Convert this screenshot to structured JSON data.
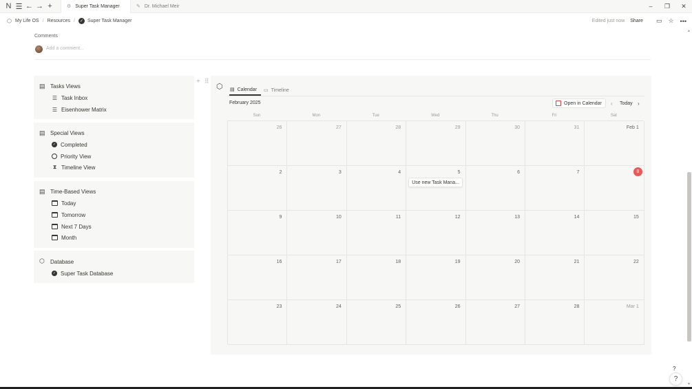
{
  "titlebar": {
    "tabs": [
      {
        "label": "Super Task Manager",
        "active": true
      },
      {
        "label": "Dr. Michael Meir",
        "active": false
      }
    ]
  },
  "breadcrumb": {
    "items": [
      "My Life OS",
      "Resources",
      "Super Task Manager"
    ],
    "edited": "Edited just now",
    "share": "Share"
  },
  "comments": {
    "label": "Comments",
    "placeholder": "Add a comment..."
  },
  "groups": [
    {
      "title": "Tasks Views",
      "icon": "calendar-icon",
      "items": [
        {
          "label": "Task Inbox",
          "icon": "checklist-icon"
        },
        {
          "label": "Eisenhower Matrix",
          "icon": "checklist-icon"
        }
      ]
    },
    {
      "title": "Special Views",
      "icon": "calendar-icon",
      "items": [
        {
          "label": "Completed",
          "icon": "check-circle-icon"
        },
        {
          "label": "Priority View",
          "icon": "circle-outline-icon"
        },
        {
          "label": "Timeline View",
          "icon": "hourglass-icon"
        }
      ]
    },
    {
      "title": "Time-Based Views",
      "icon": "calendar-icon",
      "items": [
        {
          "label": "Today",
          "icon": "calendar-icon"
        },
        {
          "label": "Tomorrow",
          "icon": "calendar-icon"
        },
        {
          "label": "Next 7 Days",
          "icon": "calendar-icon"
        },
        {
          "label": "Month",
          "icon": "calendar-icon"
        }
      ]
    },
    {
      "title": "Database",
      "icon": "database-icon",
      "items": [
        {
          "label": "Super Task Database",
          "icon": "check-circle-icon"
        }
      ]
    }
  ],
  "calendar": {
    "view_tabs": [
      "Calendar",
      "Timeline"
    ],
    "active_view": "Calendar",
    "month_label": "February 2025",
    "open_in_calendar": "Open in Calendar",
    "today_label": "Today",
    "weekdays": [
      "Sun",
      "Mon",
      "Tue",
      "Wed",
      "Thu",
      "Fri",
      "Sat"
    ],
    "weeks": [
      [
        "26",
        "27",
        "28",
        "29",
        "30",
        "31",
        "Feb 1"
      ],
      [
        "2",
        "3",
        "4",
        "5",
        "6",
        "7",
        "8"
      ],
      [
        "9",
        "10",
        "11",
        "12",
        "13",
        "14",
        "15"
      ],
      [
        "16",
        "17",
        "18",
        "19",
        "20",
        "21",
        "22"
      ],
      [
        "23",
        "24",
        "25",
        "26",
        "27",
        "28",
        "Mar 1"
      ]
    ],
    "today": "8",
    "event": {
      "label": "Use new Task Mana...",
      "date": "5"
    }
  },
  "colors": {
    "accent_today": "#eb5757",
    "panel_bg": "#f7f7f5",
    "text": "#37352f"
  }
}
